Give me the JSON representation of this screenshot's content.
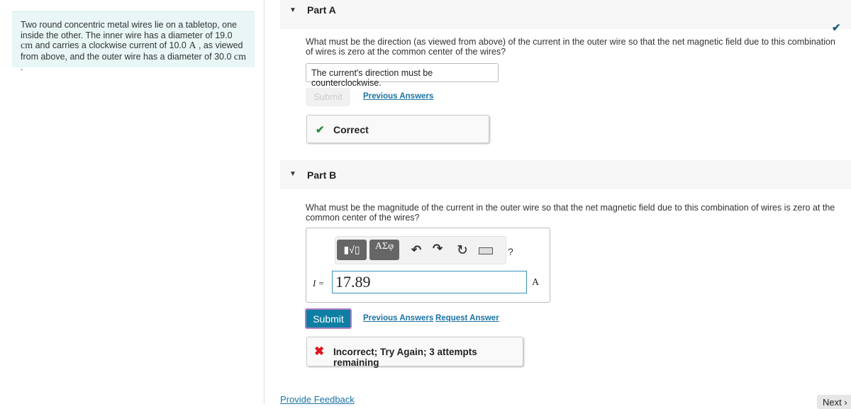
{
  "problem": {
    "text_1": "Two round concentric metal wires lie on a tabletop, one inside the other. The inner wire has a diameter of 19.0 ",
    "unit_cm": "cm",
    "text_2": " and carries a clockwise current of 10.0 ",
    "unit_A": "A",
    "text_3": " , as viewed from above, and the outer wire has a diameter of 30.0 ",
    "unit_cm2": "cm",
    "text_4": " ."
  },
  "partA": {
    "title": "Part A",
    "question": "What must be the direction (as viewed from above) of the current in the outer wire so that the net magnetic field due to this combination of wires is zero at the common center of the wires?",
    "answer": "The current's direction must be counterclockwise.",
    "submit": "Submit",
    "previous": "Previous Answers",
    "feedback": "Correct",
    "status_icon": "checkmark"
  },
  "partB": {
    "title": "Part B",
    "question": "What must be the magnitude of the current in the outer wire so that the net magnetic field due to this combination of wires is zero at the common center of the wires?",
    "toolbar": {
      "templates": "▮√▯",
      "symbols": "ΑΣφ",
      "help": "?"
    },
    "var_label": "I =",
    "value": "17.89",
    "unit": "A",
    "submit": "Submit",
    "previous": "Previous Answers",
    "request": "Request Answer",
    "feedback": "Incorrect; Try Again; 3 attempts remaining"
  },
  "footer": {
    "feedback_link": "Provide Feedback",
    "next": "Next"
  },
  "colors": {
    "accent": "#0f7ea3",
    "correct": "#2a8a3e",
    "incorrect": "#e0141e",
    "submit_focus": "#b27fc7"
  }
}
